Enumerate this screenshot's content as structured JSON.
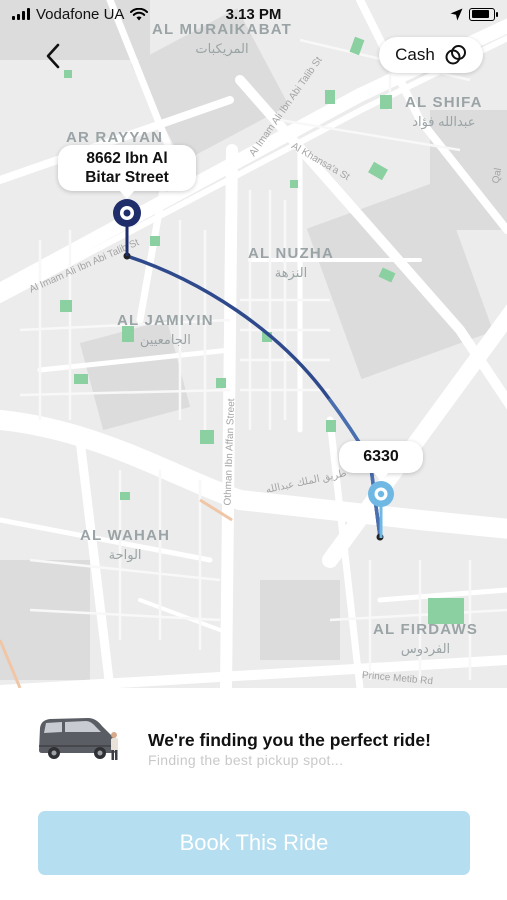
{
  "status_bar": {
    "carrier": "Vodafone UA",
    "time": "3.13 PM",
    "icons": [
      "signal-icon",
      "wifi-icon",
      "location-arrow-icon",
      "battery-icon"
    ]
  },
  "header": {
    "back_icon": "chevron-left-icon",
    "payment_label": "Cash",
    "payment_icon": "cash-icon"
  },
  "map": {
    "districts": [
      {
        "name": "AL MURAIKABAT",
        "arabic": "المريكبات"
      },
      {
        "name": "AL SHIFA",
        "arabic": "عبدالله فؤاد"
      },
      {
        "name": "AR RAYYAN",
        "arabic": ""
      },
      {
        "name": "AL NUZHA",
        "arabic": "النزهة"
      },
      {
        "name": "AL JAMIYIN",
        "arabic": "الجامعيين"
      },
      {
        "name": "AL WAHAH",
        "arabic": "الواحة"
      },
      {
        "name": "AL FIRDAWS",
        "arabic": "الفردوس"
      }
    ],
    "streets": [
      "Al Imam Ali Ibn Abi Talib St",
      "Al Khansa'a St",
      "Al Imam Ali Ibn Abi Talib St",
      "Othman Ibn Affan Street",
      "طريق الملك عبدالله",
      "Prince Metib Rd",
      "Qal"
    ],
    "pickup": {
      "label": "8662 Ibn Al Bitar Street",
      "label_line1": "8662 Ibn Al",
      "label_line2": "Bitar Street",
      "pin_color": "#1f2d6b"
    },
    "dropoff": {
      "label": "6330",
      "pin_color": "#6fb8e4"
    },
    "route_color": "#2f4a8c"
  },
  "ride": {
    "vehicle_icon": "van-icon",
    "title": "We're finding you the perfect ride!",
    "subtitle": "Finding the best pickup spot..."
  },
  "book_button_label": "Book This Ride",
  "colors": {
    "book_button": "#b5def0",
    "map_background": "#ececec",
    "park": "#8ad0a0"
  }
}
